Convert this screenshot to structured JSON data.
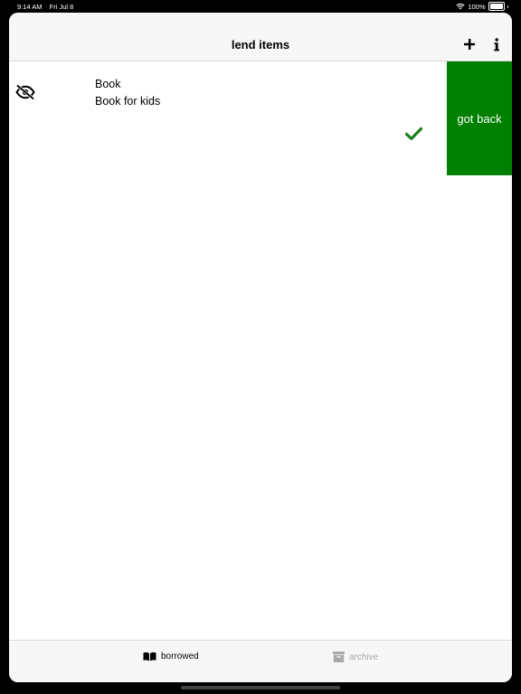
{
  "status_bar": {
    "time": "9:14 AM",
    "date": "Fri Jul 8",
    "battery": "100%",
    "battery_level": 1.0,
    "wifi_icon": "wifi-icon"
  },
  "nav": {
    "title": "lend items",
    "add_icon": "plus-icon",
    "info_icon": "info-icon"
  },
  "items": [
    {
      "title": "Book",
      "subtitle": "Book for kids",
      "visibility_icon": "eye-slash-icon",
      "status_icon": "checkmark-icon",
      "swipe_action": "got back"
    }
  ],
  "tabs": [
    {
      "label": "borrowed",
      "icon": "book-icon",
      "selected": true
    },
    {
      "label": "archive",
      "icon": "archive-box-icon",
      "selected": false
    }
  ],
  "colors": {
    "accent_green": "#008000",
    "check_green": "#1b7f1b",
    "tab_inactive": "#a8a8a8",
    "bar_background": "#f7f7f7"
  }
}
